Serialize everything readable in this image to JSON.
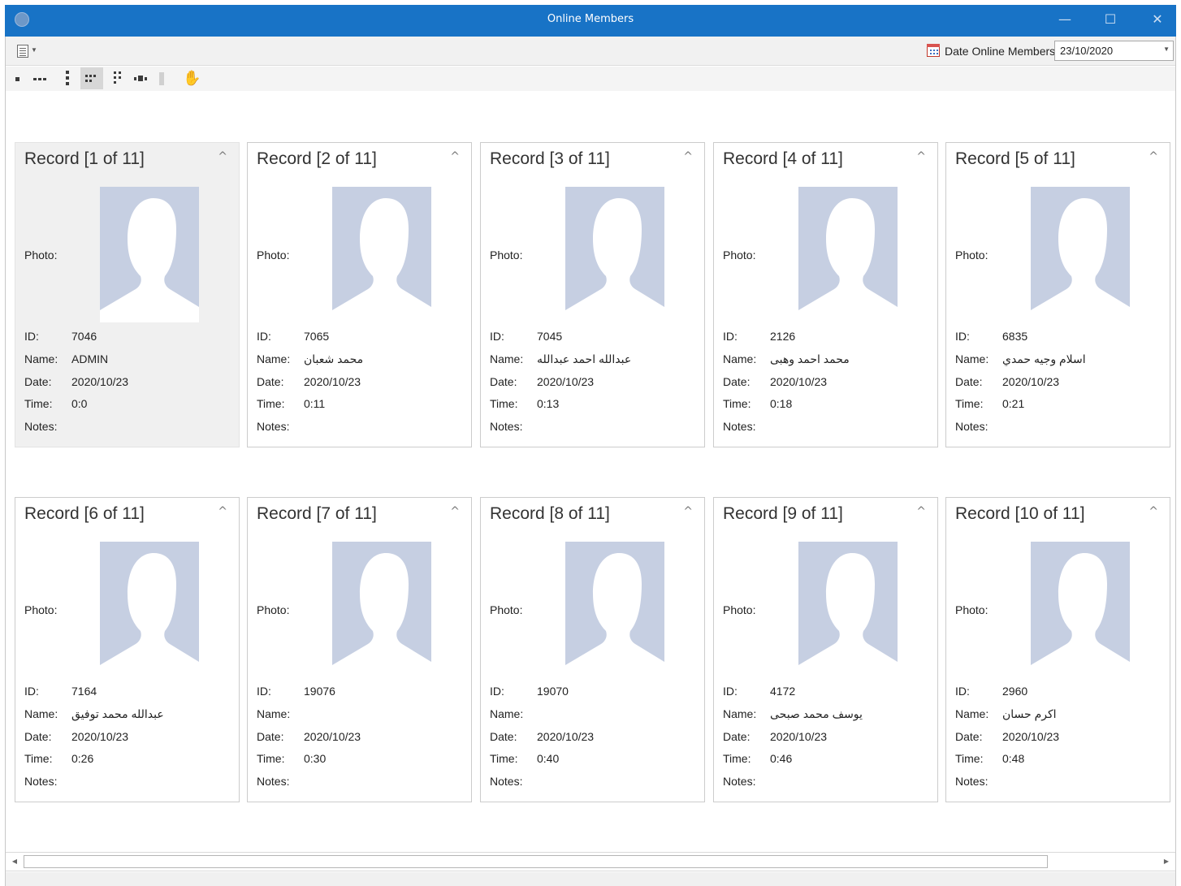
{
  "window": {
    "title": "Online Members",
    "app_icon": "globe-icon",
    "controls": {
      "minimize": "—",
      "maximize": "☐",
      "close": "✕"
    }
  },
  "toolbar": {
    "layout_menu_icon": "layout-menu-icon",
    "date_label": "Date Online Members :",
    "date_value": "23/10/2020",
    "date_icon": "calendar-icon"
  },
  "layout_toolbar": {
    "buttons": [
      "single-card-icon",
      "row-of-cards-icon",
      "column-of-cards-icon",
      "multi-row-icon",
      "multi-column-icon",
      "auto-layout-icon",
      "separator",
      "pan-hand-icon"
    ],
    "active": "multi-row-icon"
  },
  "field_labels": {
    "photo": "Photo:",
    "id": "ID:",
    "name": "Name:",
    "date": "Date:",
    "time": "Time:",
    "notes": "Notes:"
  },
  "records": [
    {
      "title": "Record [1 of 11]",
      "id": "7046",
      "name": "ADMIN",
      "date": "2020/10/23",
      "time": "0:0",
      "notes": ""
    },
    {
      "title": "Record [2 of 11]",
      "id": "7065",
      "name": "محمد شعبان",
      "date": "2020/10/23",
      "time": "0:11",
      "notes": ""
    },
    {
      "title": "Record [3 of 11]",
      "id": "7045",
      "name": "عبدالله احمد عبدالله",
      "date": "2020/10/23",
      "time": "0:13",
      "notes": ""
    },
    {
      "title": "Record [4 of 11]",
      "id": "2126",
      "name": "محمد احمد وهبى",
      "date": "2020/10/23",
      "time": "0:18",
      "notes": ""
    },
    {
      "title": "Record [5 of 11]",
      "id": "6835",
      "name": "اسلام وجيه حمدي",
      "date": "2020/10/23",
      "time": "0:21",
      "notes": ""
    },
    {
      "title": "Record [6 of 11]",
      "id": "7164",
      "name": "عبدالله محمد توفيق",
      "date": "2020/10/23",
      "time": "0:26",
      "notes": ""
    },
    {
      "title": "Record [7 of 11]",
      "id": "19076",
      "name": "",
      "date": "2020/10/23",
      "time": "0:30",
      "notes": ""
    },
    {
      "title": "Record [8 of 11]",
      "id": "19070",
      "name": "",
      "date": "2020/10/23",
      "time": "0:40",
      "notes": ""
    },
    {
      "title": "Record [9 of 11]",
      "id": "4172",
      "name": "يوسف محمد صبحى",
      "date": "2020/10/23",
      "time": "0:46",
      "notes": ""
    },
    {
      "title": "Record [10 of 11]",
      "id": "2960",
      "name": "اكرم حسان",
      "date": "2020/10/23",
      "time": "0:48",
      "notes": ""
    }
  ],
  "selected_record": 0,
  "colors": {
    "titlebar": "#1873c6",
    "photo_placeholder": "#c6cfe2",
    "selected_card": "#f0f0f0"
  }
}
